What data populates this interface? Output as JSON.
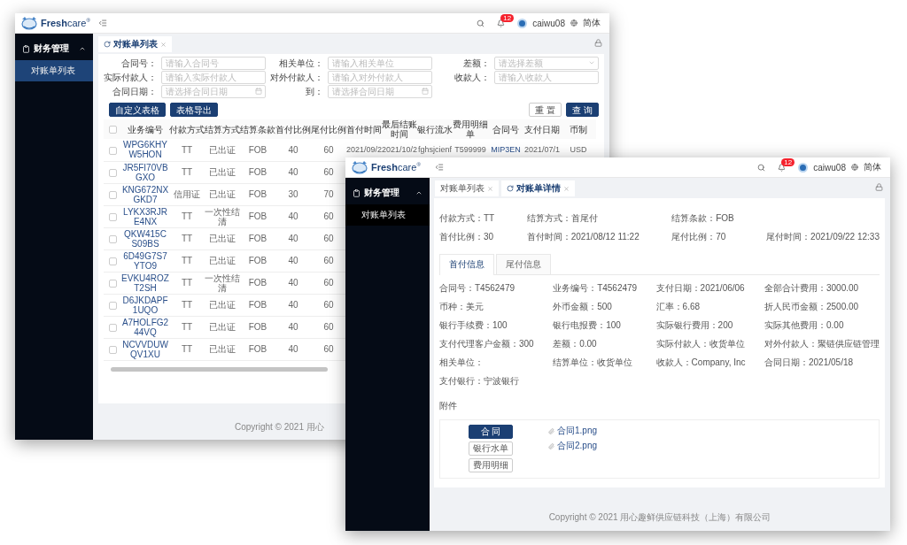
{
  "back_window": {
    "logo": "**Fresh**care$^{®}$",
    "header": {
      "notifications": "12",
      "user": "caiwu08",
      "language": "简体"
    },
    "sidebar": {
      "group": {
        "label": "财务管理",
        "expanded": true
      },
      "items": [
        {
          "label": "对账单列表",
          "selected": true
        }
      ]
    },
    "tabs": [
      {
        "label": "对账单列表",
        "selected": true
      }
    ],
    "filters": [
      {
        "label": "合同号：",
        "placeholder": "请输入合同号",
        "kind": "text"
      },
      {
        "label": "相关单位：",
        "placeholder": "请输入相关单位",
        "kind": "text"
      },
      {
        "label": "差额：",
        "placeholder": "请选择差额",
        "kind": "select"
      },
      {
        "label": "实际付款人：",
        "placeholder": "请输入实际付款人",
        "kind": "text"
      },
      {
        "label": "对外付款人：",
        "placeholder": "请输入对外付款人",
        "kind": "text"
      },
      {
        "label": "收款人：",
        "placeholder": "请输入收款人",
        "kind": "text"
      },
      {
        "label": "合同日期：",
        "placeholder": "请选择合同日期",
        "kind": "date"
      },
      {
        "label": "到：",
        "placeholder": "请选择合同日期",
        "kind": "date"
      }
    ],
    "actions": [
      "自定义表格",
      "表格导出"
    ],
    "form_buttons": [
      {
        "label": "重 置",
        "kind": "default"
      },
      {
        "label": "查 询",
        "kind": "primary"
      }
    ],
    "table": {
      "select_all": {
        "checked": false
      },
      "columns": [
        {
          "label": "业务编号",
          "kind": "link"
        },
        {
          "label": "付款方式",
          "kind": "text"
        },
        {
          "label": "结算方式",
          "kind": "text"
        },
        {
          "label": "结算条款",
          "kind": "text"
        },
        {
          "label": "首付比例",
          "kind": "text"
        },
        {
          "label": "尾付比例",
          "kind": "text"
        },
        {
          "label": "首付时间",
          "kind": "text"
        },
        {
          "label": "最后结账时间",
          "kind": "text"
        },
        {
          "label": "银行流水",
          "kind": "text"
        },
        {
          "label": "费用明细单",
          "kind": "text"
        },
        {
          "label": "合同号",
          "kind": "link"
        },
        {
          "label": "支付日期",
          "kind": "text"
        },
        {
          "label": "币制",
          "kind": "text"
        }
      ],
      "rows": [
        {
          "checked": false,
          "cells": [
            "WPG6KHYW5HON",
            "TT",
            "已出证",
            "FOB",
            "40",
            "60",
            "2021/09/2",
            "2021/10/2",
            "fghsjcienf",
            "T599999",
            "MIP3EN",
            "2021/07/1",
            "USD"
          ]
        },
        {
          "checked": false,
          "cells": [
            "JR5FI70VBGXO",
            "TT",
            "已出证",
            "FOB",
            "40",
            "60"
          ]
        },
        {
          "checked": false,
          "cells": [
            "KNG672NXGKD7",
            "信用证",
            "已出证",
            "FOB",
            "30",
            "70"
          ]
        },
        {
          "checked": false,
          "cells": [
            "LYKX3RJRE4NX",
            "TT",
            "一次性结清",
            "FOB",
            "40",
            "60"
          ]
        },
        {
          "checked": false,
          "cells": [
            "QKW415CS09BS",
            "TT",
            "已出证",
            "FOB",
            "40",
            "60"
          ]
        },
        {
          "checked": false,
          "cells": [
            "6D49G7S7YTO9",
            "TT",
            "已出证",
            "FOB",
            "40",
            "60"
          ]
        },
        {
          "checked": false,
          "cells": [
            "EVKU4ROZT2SH",
            "TT",
            "一次性结清",
            "FOB",
            "40",
            "60"
          ]
        },
        {
          "checked": false,
          "cells": [
            "D6JKDAPF1UQO",
            "TT",
            "已出证",
            "FOB",
            "40",
            "60"
          ]
        },
        {
          "checked": false,
          "cells": [
            "A7HOLFG244VQ",
            "TT",
            "已出证",
            "FOB",
            "40",
            "60"
          ]
        },
        {
          "checked": false,
          "cells": [
            "NCVVDUWQV1XU",
            "TT",
            "已出证",
            "FOB",
            "40",
            "60"
          ]
        }
      ]
    },
    "footer": "Copyright © 2021 用心"
  },
  "front_window": {
    "logo": "**Fresh**care$^{®}$",
    "header": {
      "notifications": "12",
      "user": "caiwu08",
      "language": "简体"
    },
    "sidebar": {
      "group": {
        "label": "财务管理",
        "expanded": true
      },
      "items": [
        {
          "label": "对账单列表",
          "selected": false
        }
      ]
    },
    "tabs": [
      {
        "label": "对账单列表",
        "selected": false
      },
      {
        "label": "对账单详情",
        "selected": true
      }
    ],
    "summary": [
      [
        "付款方式：TT",
        "结算方式：首尾付",
        "结算条款：FOB"
      ],
      [
        "首付比例：30",
        "首付时间：2021/08/12 11:22",
        "尾付比例：70",
        "尾付时间：2021/09/22 12:33"
      ]
    ],
    "info_tabs": [
      {
        "label": "首付信息",
        "selected": true
      },
      {
        "label": "尾付信息",
        "selected": false
      }
    ],
    "fields": [
      "合同号：T4562479",
      "业务编号：T4562479",
      "支付日期：2021/06/06",
      "全部合计费用：3000.00",
      "币种：美元",
      "外币金额：500",
      "汇率：6.68",
      "折人民币金额：2500.00",
      "银行手续费：100",
      "银行电报费：100",
      "实际银行费用：200",
      "实际其他费用：0.00",
      "支付代理客户金额：300",
      "差额：0.00",
      "实际付款人：收货单位",
      "对外付款人：聚链供应链管理",
      "相关单位：",
      "结算单位：收货单位",
      "收款人：Company, Inc",
      "合同日期：2021/05/18",
      "支付银行：宁波银行"
    ],
    "attachments_title": "附件",
    "attachment_types": [
      {
        "label": "合 同",
        "selected": true
      },
      {
        "label": "银行水单",
        "selected": false
      },
      {
        "label": "费用明细",
        "selected": false
      }
    ],
    "files": [
      "合同1.png",
      "合同2.png"
    ],
    "footer": "Copyright © 2021 用心趣鲜供应链科技（上海）有限公司"
  }
}
